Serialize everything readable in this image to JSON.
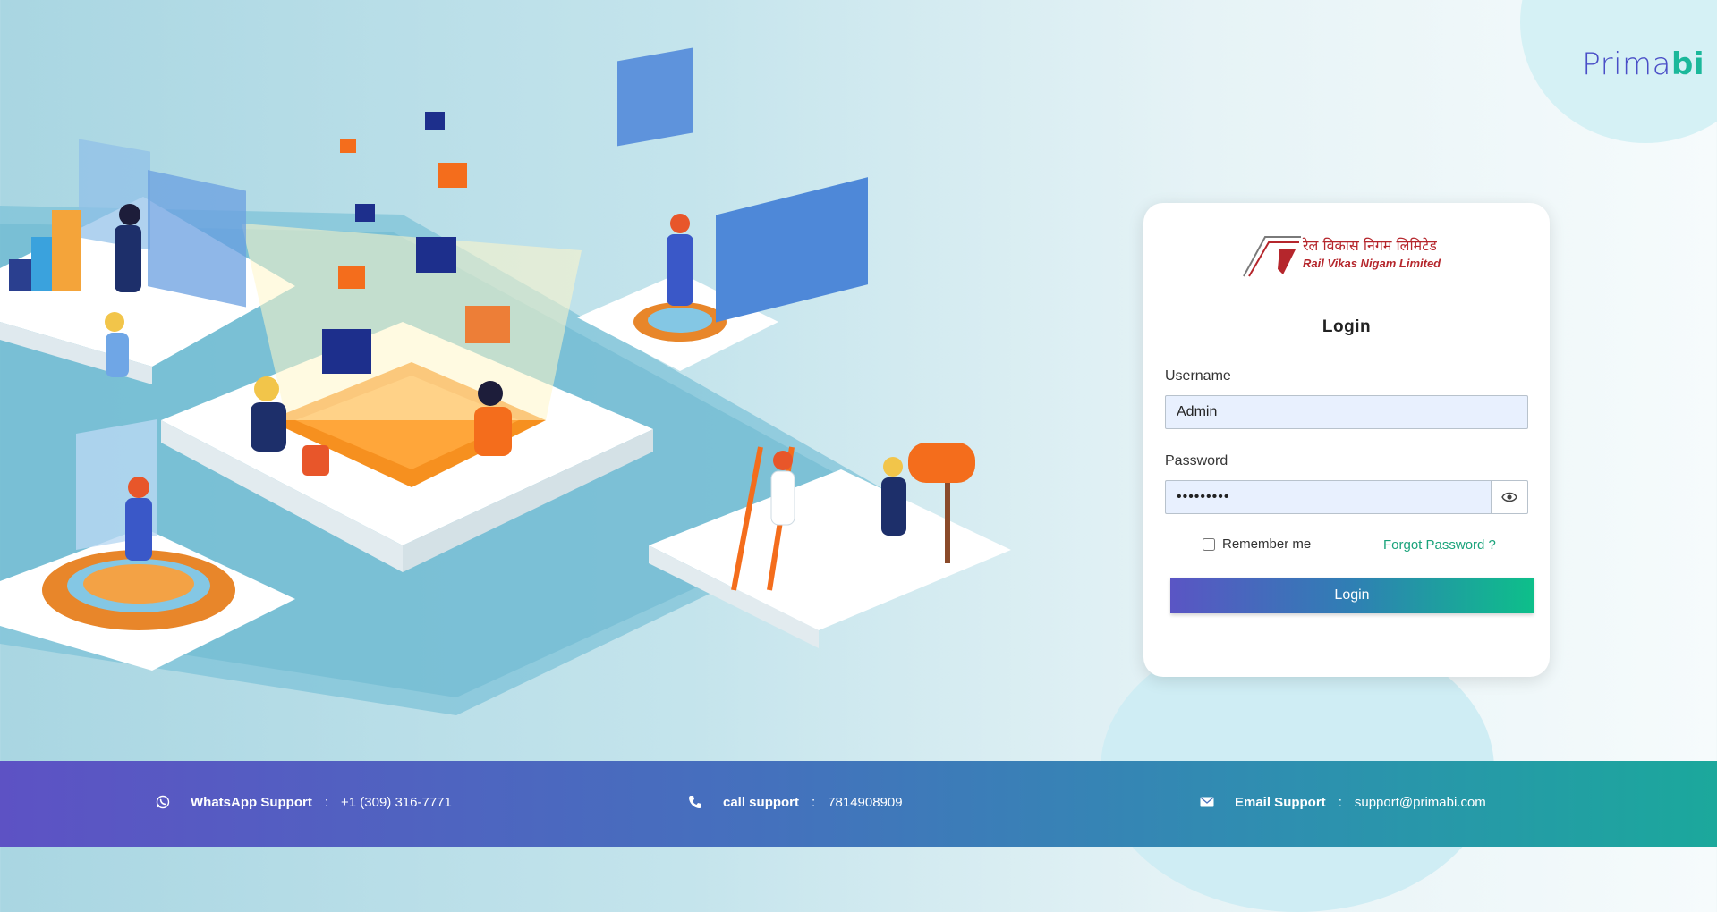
{
  "brand": {
    "name_part1": "Prima",
    "name_part2": "bi",
    "color_primary": "#4a4ec7",
    "color_accent": "#1bb89a"
  },
  "organization": {
    "name_hindi": "रेल विकास निगम लिमिटेड",
    "name_english": "Rail Vikas Nigam Limited",
    "logo_icon": "rvnl-logo-icon",
    "color": "#b5262c"
  },
  "login": {
    "title": "Login",
    "username_label": "Username",
    "username_value": "Admin",
    "password_label": "Password",
    "password_value": "•••••••••",
    "show_password_icon": "eye-icon",
    "remember_label": "Remember me",
    "remember_checked": false,
    "forgot_label": "Forgot Password ?",
    "submit_label": "Login"
  },
  "footer": {
    "whatsapp": {
      "icon": "whatsapp-icon",
      "label": "WhatsApp Support",
      "sep": ":",
      "value": "+1 (309) 316-7771"
    },
    "call": {
      "icon": "phone-icon",
      "label": "call support",
      "sep": ":",
      "value": "7814908909"
    },
    "email": {
      "icon": "envelope-icon",
      "label": "Email Support",
      "sep": ":",
      "value": "support@primabi.com"
    }
  }
}
